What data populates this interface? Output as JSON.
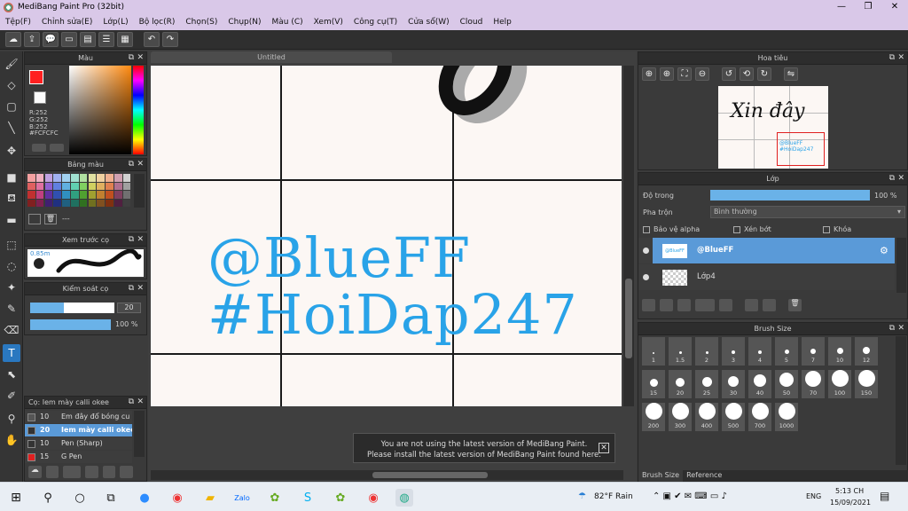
{
  "window": {
    "title": "MediBang Paint Pro (32bit)"
  },
  "menu": [
    "Tệp(F)",
    "Chỉnh sửa(E)",
    "Lớp(L)",
    "Bộ lọc(R)",
    "Chọn(S)",
    "Chụp(N)",
    "Màu (C)",
    "Xem(V)",
    "Công cụ(T)",
    "Cửa sổ(W)",
    "Cloud",
    "Help"
  ],
  "color_panel": {
    "title": "Màu",
    "r": "R:252",
    "g": "G:252",
    "b": "B:252",
    "hex": "#FCFCFC",
    "primary": "#ff2020",
    "secondary": "#fcfcfc"
  },
  "palette_panel": {
    "title": "Bảng màu",
    "name": "---",
    "swatches": [
      "#f4a0a0",
      "#f0b0c0",
      "#c0a0e0",
      "#a0b0f0",
      "#a0d0f0",
      "#a0e0d0",
      "#b0e0a0",
      "#e0e0a0",
      "#f0d0a0",
      "#f0b090",
      "#d0a0b0",
      "#d0d0d0",
      "#e06060",
      "#e070a0",
      "#9060d0",
      "#6080e0",
      "#60b0e0",
      "#60d0b0",
      "#80d060",
      "#d0d060",
      "#e0b060",
      "#e08050",
      "#b07090",
      "#a0a0a0",
      "#c03030",
      "#c04080",
      "#6030a0",
      "#3050b0",
      "#3090c0",
      "#30a080",
      "#50a030",
      "#a0a030",
      "#c08030",
      "#c05020",
      "#804060",
      "#707070",
      "#802020",
      "#802050",
      "#402070",
      "#203080",
      "#206080",
      "#207060",
      "#307020",
      "#707020",
      "#805020",
      "#803010",
      "#502040",
      "#404040"
    ]
  },
  "brush_preview": {
    "title": "Xem trước cọ",
    "size": "0.85m"
  },
  "brush_control": {
    "title": "Kiểm soát cọ",
    "size_value": "20",
    "opacity_value": "100 %",
    "size_fraction": 0.4,
    "opacity_fraction": 1.0
  },
  "brush_list": {
    "title": "Cọ: Iem mày calli okee",
    "items": [
      {
        "size": "10",
        "name": "Em đây đổ bóng cu",
        "color": "#555555",
        "selected": false
      },
      {
        "size": "20",
        "name": "Iem mày calli okee",
        "color": "#333333",
        "selected": true
      },
      {
        "size": "10",
        "name": "Pen (Sharp)",
        "color": "#333333",
        "selected": false
      },
      {
        "size": "15",
        "name": "G Pen",
        "color": "#e02020",
        "selected": false
      }
    ]
  },
  "document": {
    "tab": "Untitled",
    "text_line1": "@BlueFF",
    "text_line2": "#HoiDap247"
  },
  "notice": {
    "line1": "You are not using the latest version of MediBang Paint.",
    "line2": "Please install the latest version of MediBang Paint found here.",
    "close": "✕"
  },
  "navigator": {
    "title": "Hoa tiêu",
    "preview_text": "Xin đây",
    "preview_small": "@BlueFF #HoiDap247"
  },
  "layer_panel": {
    "title": "Lớp",
    "opacity_label": "Độ trong",
    "opacity_value": "100 %",
    "blend_label": "Pha trộn",
    "blend_value": "Bình thường",
    "protect_alpha": "Bảo vệ alpha",
    "clip": "Xén bớt",
    "lock": "Khóa",
    "layers": [
      {
        "name": "@BlueFF",
        "selected": true
      },
      {
        "name": "Lớp4",
        "selected": false
      }
    ]
  },
  "brush_size_panel": {
    "title": "Brush Size",
    "sizes": [
      "1",
      "1.5",
      "2",
      "3",
      "4",
      "5",
      "7",
      "10",
      "12",
      "15",
      "20",
      "25",
      "30",
      "40",
      "50",
      "70",
      "100",
      "150",
      "200",
      "300",
      "400",
      "500",
      "700",
      "1000"
    ],
    "tabs": [
      "Brush Size",
      "Reference"
    ]
  },
  "taskbar": {
    "weather": "82°F  Rain",
    "lang": "ENG",
    "time": "5:13 CH",
    "date": "15/09/2021"
  }
}
